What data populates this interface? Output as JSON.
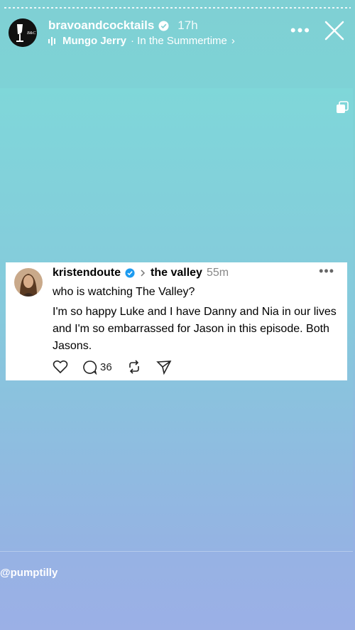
{
  "story": {
    "username": "bravoandcocktails",
    "time": "17h",
    "music_artist": "Mungo Jerry",
    "music_song": "· In the Summertime",
    "music_chevron": "›"
  },
  "post": {
    "username": "kristendoute",
    "topic": "the valley",
    "time": "55m",
    "line1": "who is watching The Valley?",
    "line2": "I'm so happy Luke and I have Danny and Nia in our lives and I'm so embarrassed for Jason in this episode. Both Jasons.",
    "reply_count": "36"
  },
  "mention": "@pumptilly",
  "icons": {
    "verified": "verified-badge-icon",
    "more": "more-options-icon",
    "close": "close-icon",
    "heart": "heart-icon",
    "comment": "comment-icon",
    "repost": "repost-icon",
    "share": "send-icon",
    "copy": "copy-icon"
  },
  "colors": {
    "verified_blue": "#1d9bf0",
    "bg_top": "#7fd0d4",
    "bg_bottom": "#9bb0e6"
  }
}
